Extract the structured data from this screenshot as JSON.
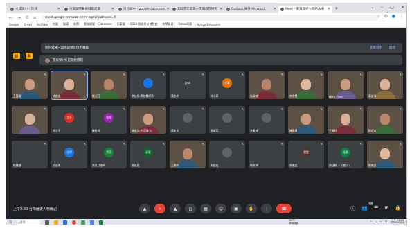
{
  "browser": {
    "tabs": [
      {
        "title": "大成國小 - 首頁"
      },
      {
        "title": "台灣國際醫療健康產業"
      },
      {
        "title": "南台國中 - googleclassroom"
      },
      {
        "title": "112學年度第一學期教學研究"
      },
      {
        "title": "Outlook 郵件 Microsoft"
      },
      {
        "title": "Meet - 臺灣歷史人物的故事"
      }
    ],
    "new_tab": "+",
    "window_controls": [
      "⌄",
      "–",
      "▢",
      "✕"
    ],
    "nav": [
      "←",
      "→",
      "C",
      "⌂"
    ],
    "url": "meet.google.com/czz-onmr-bgm?authuser=0",
    "bookmarks": [
      "Google",
      "Gmail",
      "YouTube",
      "地圖",
      "翻譯",
      "新聞",
      "雲端硬碟 - Classroom",
      "行事曆",
      "2023 綠能科技博覽會",
      "教學資源",
      "Yahoo奇摩",
      "Notion Extension"
    ]
  },
  "meet": {
    "banner_text": "你的會議已開始錄製並啟用轉錄",
    "banner_actions": [
      "查看說明",
      "關閉"
    ],
    "side_buttons": [
      "鋼",
      "筆"
    ],
    "pinned": {
      "name": "張家榮(你)",
      "text": "張家榮(你)已開始簡報"
    },
    "tiles": [
      [
        {
          "name": "王富國",
          "type": "video"
        },
        {
          "name": "林俊宏",
          "type": "video",
          "highlight": true
        },
        {
          "name": "陳淑芬",
          "type": "video"
        },
        {
          "name": "李佳玲(學校輔導室)",
          "type": "avatar",
          "color": "#1a73e8",
          "initial": ""
        },
        {
          "name": "黃志明",
          "type": "avatar",
          "color": "#3c4043",
          "initial": "許83"
        },
        {
          "name": "林小華",
          "type": "avatar",
          "color": "#e37400",
          "initial": "小華"
        },
        {
          "name": "吳淑敏",
          "type": "video"
        },
        {
          "name": "李宗賢",
          "type": "video"
        },
        {
          "name": "Holly Chen",
          "type": "video"
        },
        {
          "name": "張志偉",
          "type": "video"
        }
      ],
      [
        {
          "name": "",
          "type": "video"
        },
        {
          "name": "許立平",
          "type": "avatar",
          "color": "#d93025",
          "initial": "立平"
        },
        {
          "name": "陳怡秀",
          "type": "avatar",
          "color": "#9c27b0",
          "initial": "怡秀"
        },
        {
          "name": "林宏志(中正國小)",
          "type": "video"
        },
        {
          "name": "蔡宏文",
          "type": "avatar",
          "color": "#5f6368",
          "initial": ""
        },
        {
          "name": "劉淑芳",
          "type": "avatar",
          "color": "#5f6368",
          "initial": ""
        },
        {
          "name": "李雅婷",
          "type": "avatar",
          "color": "#5f6368",
          "initial": ""
        },
        {
          "name": "陳雅琪",
          "type": "video"
        },
        {
          "name": "王美玲",
          "type": "video"
        },
        {
          "name": "簡志宏",
          "type": "video"
        }
      ],
      [
        {
          "name": "楊建國",
          "type": "avatar",
          "color": "#3c4043",
          "initial": ""
        },
        {
          "name": "柯志明",
          "type": "avatar",
          "color": "#1a73e8",
          "initial": "志明"
        },
        {
          "name": "黃秀月老師",
          "type": "avatar",
          "color": "#188038",
          "initial": "秀月"
        },
        {
          "name": "吳淑君",
          "type": "avatar",
          "color": "#0d652d",
          "initial": "淑君"
        },
        {
          "name": "王雅玲",
          "type": "video"
        },
        {
          "name": "周建宏",
          "type": "avatar",
          "color": "#5f6368",
          "initial": ""
        },
        {
          "name": "楊淑華",
          "type": "avatar",
          "color": "#3c4043",
          "initial": ""
        },
        {
          "name": "張雅雯",
          "type": "avatar",
          "color": "#4e342e",
          "initial": "雅雯"
        },
        {
          "name": "蔡佳穎 + 小組(2)",
          "type": "avatar",
          "color": "#0b8043",
          "initial": "佳穎"
        },
        {
          "name": "鄭美惠",
          "type": "video"
        }
      ]
    ],
    "meeting_meta": "上午9:33  台灣歷史人物傳記",
    "participants_badge": "33",
    "controls": [
      {
        "icon": "▲",
        "label": "more"
      },
      {
        "icon": "✕",
        "label": "mic-off"
      },
      {
        "icon": "▲",
        "label": "more2"
      },
      {
        "icon": "◻",
        "label": "camera"
      },
      {
        "icon": "▦",
        "label": "captions"
      },
      {
        "icon": "☺",
        "label": "emoji"
      },
      {
        "icon": "▣",
        "label": "present"
      },
      {
        "icon": "✋",
        "label": "hand"
      },
      {
        "icon": "⋮",
        "label": "more-options"
      },
      {
        "icon": "☎",
        "label": "leave"
      }
    ],
    "right_controls": [
      "ⓘ",
      "👥",
      "☰",
      "⊞",
      "🔒"
    ]
  },
  "taskbar": {
    "search_placeholder": "搜尋",
    "weather": [
      "28°C",
      "晴時多雲"
    ],
    "clock": [
      "上午 09:33",
      "2024/10/14"
    ],
    "tray": [
      "^",
      "☁",
      "⊏",
      "中"
    ]
  }
}
